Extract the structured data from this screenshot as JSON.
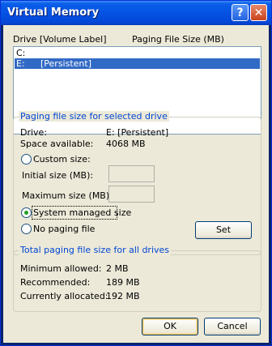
{
  "window": {
    "title": "Virtual Memory"
  },
  "titlebar": {
    "help_glyph": "?",
    "close_glyph": "✕"
  },
  "drive_list": {
    "header_drive": "Drive  [Volume Label]",
    "header_size": "Paging File Size (MB)",
    "rows": [
      {
        "drive": "C:",
        "label": "",
        "selected": false
      },
      {
        "drive": "E:",
        "label": "[Persistent]",
        "selected": true
      }
    ]
  },
  "selected_drive_group": {
    "title": "Paging file size for selected drive",
    "drive_label": "Drive:",
    "drive_value": "E:  [Persistent]",
    "space_label": "Space available:",
    "space_value": "4068 MB",
    "custom_size": "Custom size:",
    "initial_size": "Initial size (MB):",
    "maximum_size": "Maximum size (MB):",
    "system_managed": "System managed size",
    "no_paging": "No paging file",
    "selected_option": "system_managed",
    "set_button": "Set"
  },
  "total_group": {
    "title": "Total paging file size for all drives",
    "min_label": "Minimum allowed:",
    "min_value": "2 MB",
    "rec_label": "Recommended:",
    "rec_value": "189 MB",
    "cur_label": "Currently allocated:",
    "cur_value": "192 MB"
  },
  "footer": {
    "ok_label": "OK",
    "cancel_label": "Cancel"
  },
  "colors": {
    "titlebar": "#0553e3",
    "selection": "#316ac5",
    "group_title": "#0046d5",
    "dialog_bg": "#ece9d8"
  }
}
